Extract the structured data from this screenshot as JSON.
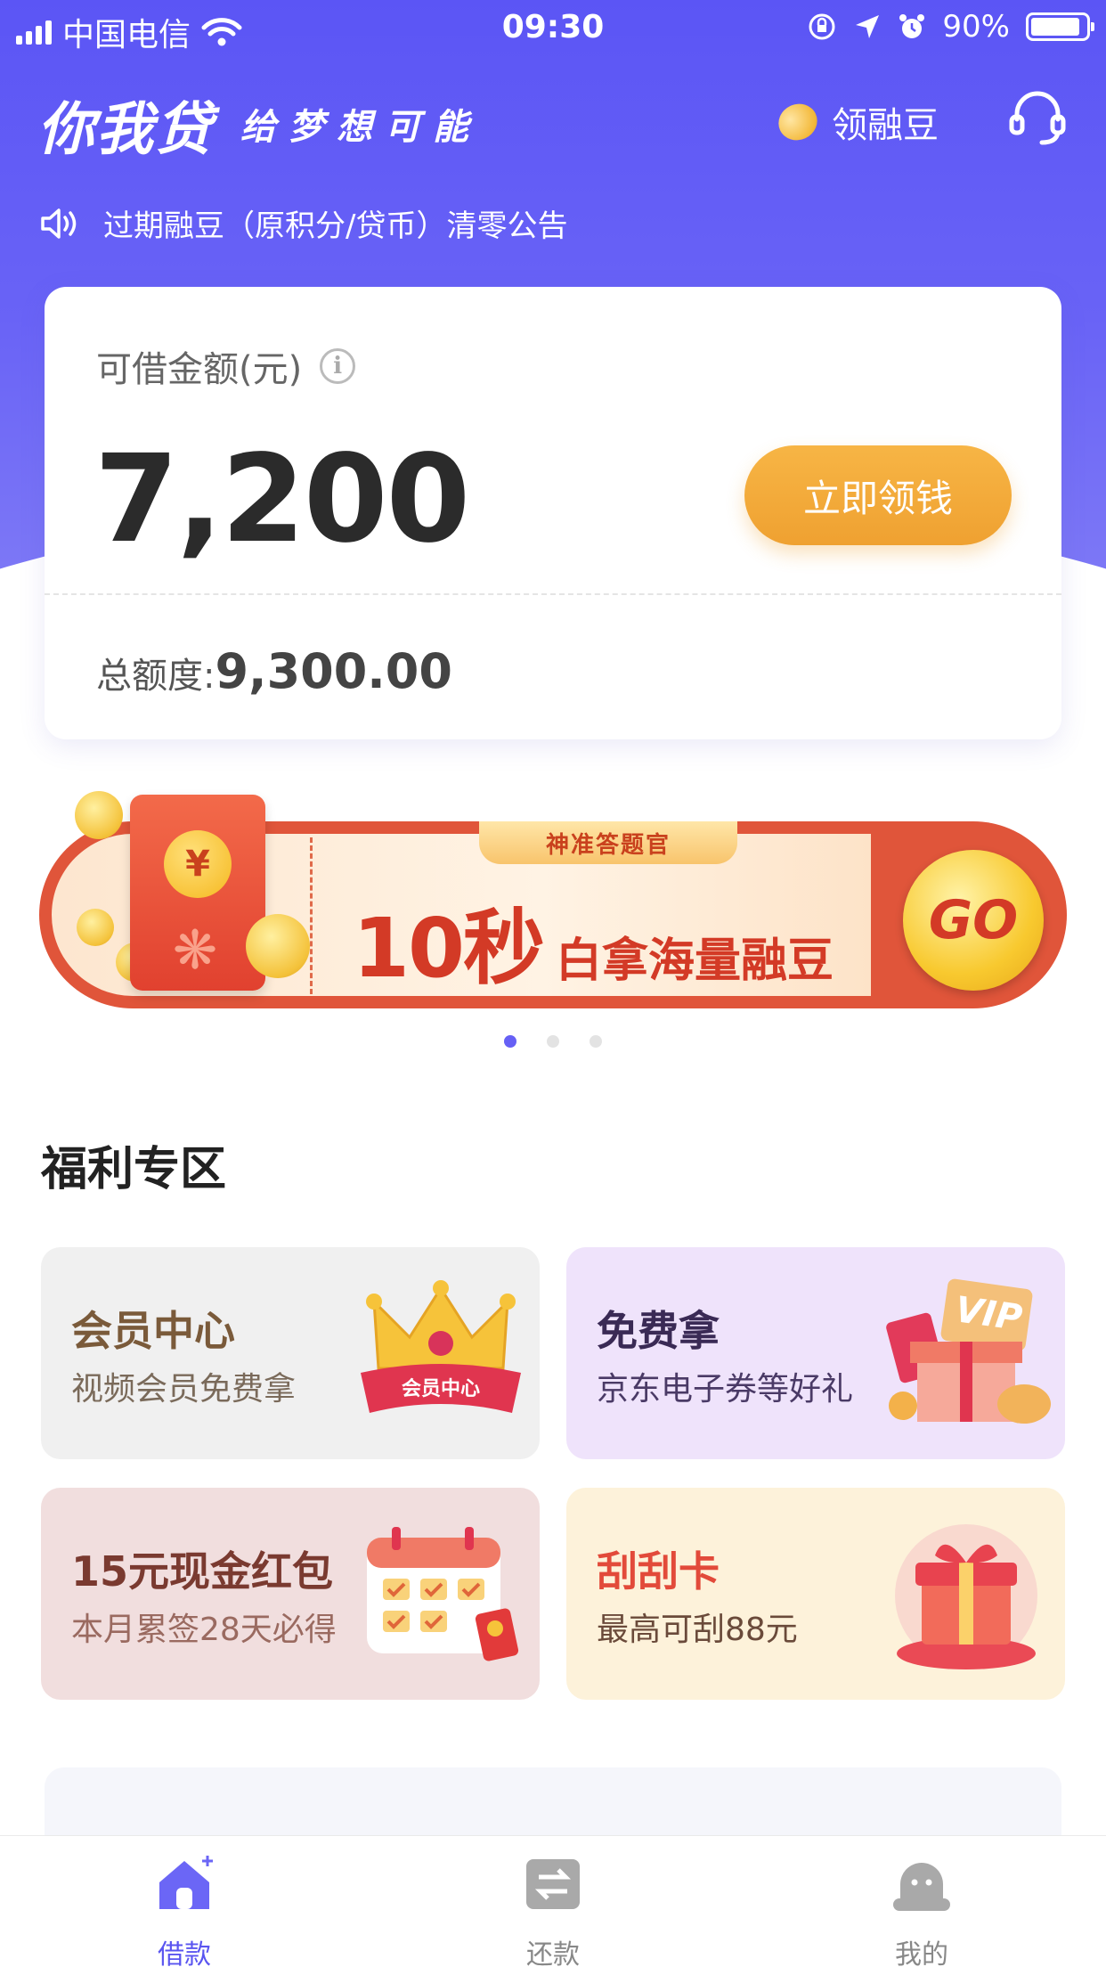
{
  "status_bar": {
    "carrier": "中国电信",
    "time": "09:30",
    "battery": "90%"
  },
  "header": {
    "logo": "你我贷",
    "slogan": "给梦想可能",
    "beans_label": "领融豆",
    "notice": "过期融豆（原积分/贷币）清零公告"
  },
  "loan_card": {
    "label": "可借金额(元)",
    "amount": "7,200",
    "button": "立即领钱",
    "total_label": "总额度:",
    "total_value": "9,300.00"
  },
  "banner": {
    "tag": "神准答题官",
    "big_text": "10秒",
    "small_text": "白拿海量融豆",
    "go": "GO",
    "yuan": "¥",
    "pages": 3,
    "active_page": 1
  },
  "welfare": {
    "title": "福利专区",
    "tiles": [
      {
        "title": "会员中心",
        "subtitle": "视频会员免费拿",
        "badge": "会员中心"
      },
      {
        "title": "免费拿",
        "subtitle": "京东电子券等好礼",
        "badge": "VIP"
      },
      {
        "title": "15元现金红包",
        "subtitle": "本月累签28天必得"
      },
      {
        "title": "刮刮卡",
        "subtitle": "最高可刮88元"
      }
    ]
  },
  "tabbar": {
    "tabs": [
      {
        "label": "借款",
        "active": true
      },
      {
        "label": "还款",
        "active": false
      },
      {
        "label": "我的",
        "active": false
      }
    ]
  },
  "colors": {
    "brand": "#5b55f5",
    "button": "#f0a232",
    "banner_red": "#e0553a"
  }
}
